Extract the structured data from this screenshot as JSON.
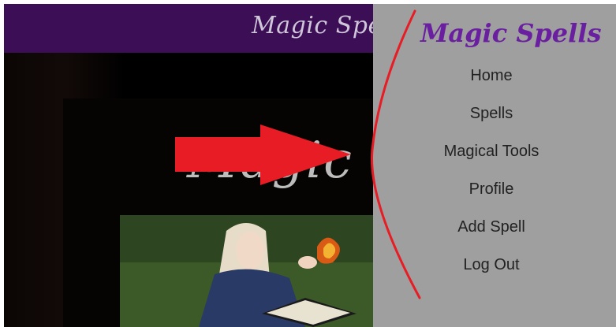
{
  "header": {
    "title": "Magic Spells"
  },
  "hero": {
    "title": "Magic Spells"
  },
  "sidebar": {
    "title": "Magic Spells",
    "items": [
      {
        "label": "Home"
      },
      {
        "label": "Spells"
      },
      {
        "label": "Magical Tools"
      },
      {
        "label": "Profile"
      },
      {
        "label": "Add Spell"
      },
      {
        "label": "Log Out"
      }
    ]
  },
  "colors": {
    "header_bg": "#3c0e55",
    "sidebar_bg": "#9f9f9f",
    "sidebar_title": "#6a1fa0",
    "annotation_red": "#e81c24"
  }
}
